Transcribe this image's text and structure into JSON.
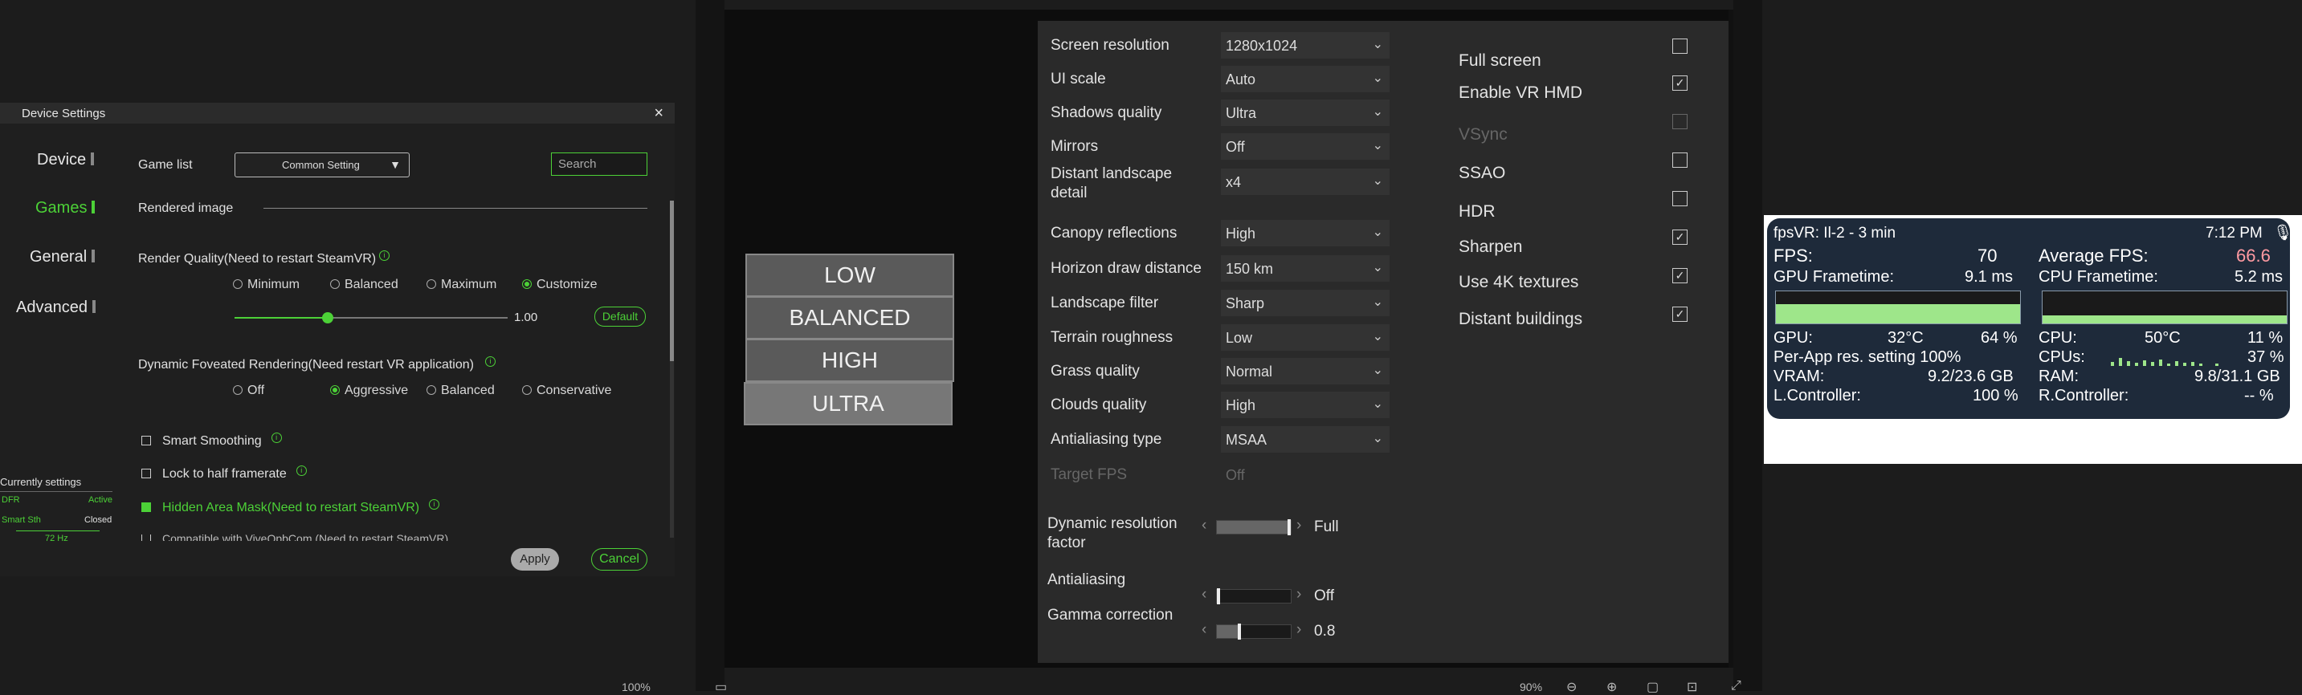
{
  "device_settings": {
    "title": "Device Settings",
    "close_icon": "×",
    "sidebar": [
      {
        "label": "Device",
        "active": false
      },
      {
        "label": "Games",
        "active": true
      },
      {
        "label": "General",
        "active": false
      },
      {
        "label": "Advanced",
        "active": false
      }
    ],
    "game_list_label": "Game list",
    "game_list_value": "Common Setting",
    "search_placeholder": "Search",
    "rendered_image_label": "Rendered image",
    "render_quality_label": "Render Quality(Need to restart SteamVR)",
    "render_quality_options": [
      "Minimum",
      "Balanced",
      "Maximum",
      "Customize"
    ],
    "render_quality_selected": "Customize",
    "render_quality_value": "1.00",
    "render_quality_fraction": 0.34,
    "default_button": "Default",
    "dfr_label": "Dynamic Foveated Rendering(Need restart VR application)",
    "dfr_options": [
      "Off",
      "Aggressive",
      "Balanced",
      "Conservative"
    ],
    "dfr_selected": "Aggressive",
    "smart_smoothing": "Smart Smoothing",
    "lock_half": "Lock to half framerate",
    "hidden_area": "Hidden Area Mask(Need to restart SteamVR)",
    "cut_text": "Compatible with ViveOpbCom (Need to restart SteamVR)",
    "apply_button": "Apply",
    "cancel_button": "Cancel",
    "current": {
      "title": "Currently settings",
      "dfr_key": "DFR",
      "dfr_val": "Active",
      "ss_key": "Smart Sth",
      "ss_val": "Closed",
      "hz": "72 Hz"
    }
  },
  "vr": {
    "presets": [
      "LOW",
      "BALANCED",
      "HIGH",
      "ULTRA"
    ],
    "settings": [
      {
        "label": "Screen resolution",
        "value": "1280x1024"
      },
      {
        "label": "UI scale",
        "value": "Auto"
      },
      {
        "label": "Shadows quality",
        "value": "Ultra"
      },
      {
        "label": "Mirrors",
        "value": "Off"
      },
      {
        "label": "Distant landscape",
        "label2": "detail",
        "value": "x4"
      },
      {
        "label": "Canopy reflections",
        "value": "High"
      },
      {
        "label": "Horizon draw distance",
        "value": "150 km"
      },
      {
        "label": "Landscape filter",
        "value": "Sharp"
      },
      {
        "label": "Terrain roughness",
        "value": "Low"
      },
      {
        "label": "Grass quality",
        "value": "Normal"
      },
      {
        "label": "Clouds quality",
        "value": "High"
      },
      {
        "label": "Antialiasing type",
        "value": "MSAA"
      },
      {
        "label": "Target FPS",
        "value": "Off"
      }
    ],
    "sliders": [
      {
        "label": "Dynamic resolution",
        "label2": "factor",
        "value": "Full",
        "fraction": 1.0
      },
      {
        "label": "Antialiasing",
        "value": "Off",
        "fraction": 0.0
      },
      {
        "label": "Gamma correction",
        "value": "0.8",
        "fraction": 0.3
      }
    ],
    "toggles": [
      {
        "label": "Full screen",
        "checked": false
      },
      {
        "label": "Enable VR HMD",
        "checked": true
      },
      {
        "label": "VSync",
        "checked": false,
        "disabled": true
      },
      {
        "label": "SSAO",
        "checked": false
      },
      {
        "label": "HDR",
        "checked": false
      },
      {
        "label": "Sharpen",
        "checked": true
      },
      {
        "label": "Use 4K textures",
        "checked": true
      },
      {
        "label": "Distant buildings",
        "checked": true
      }
    ]
  },
  "fpsvr": {
    "title": "fpsVR: Il-2 - 3 min",
    "time": "7:12 PM",
    "fps_label": "FPS:",
    "fps_value": "70",
    "avg_label": "Average FPS:",
    "avg_value": "66.6",
    "gpu_ft_label": "GPU Frametime:",
    "gpu_ft_value": "9.1 ms",
    "cpu_ft_label": "CPU Frametime:",
    "cpu_ft_value": "5.2 ms",
    "gpu_label": "GPU:",
    "gpu_temp": "32°C",
    "gpu_load": "64 %",
    "cpu_label": "CPU:",
    "cpu_temp": "50°C",
    "cpu_load": "11 %",
    "perapp": "Per-App res. setting 100%",
    "cpus_label": "CPUs:",
    "cpus_value": "37 %",
    "vram_label": "VRAM:",
    "vram_value": "9.2/23.6 GB",
    "ram_label": "RAM:",
    "ram_value": "9.8/31.1 GB",
    "lc_label": "L.Controller:",
    "lc_value": "100 %",
    "rc_label": "R.Controller:",
    "rc_value": "-- %",
    "accent_avg": "#ff9aa2"
  },
  "bottom": {
    "zoom_left": "100%",
    "zoom_right": "90%"
  }
}
